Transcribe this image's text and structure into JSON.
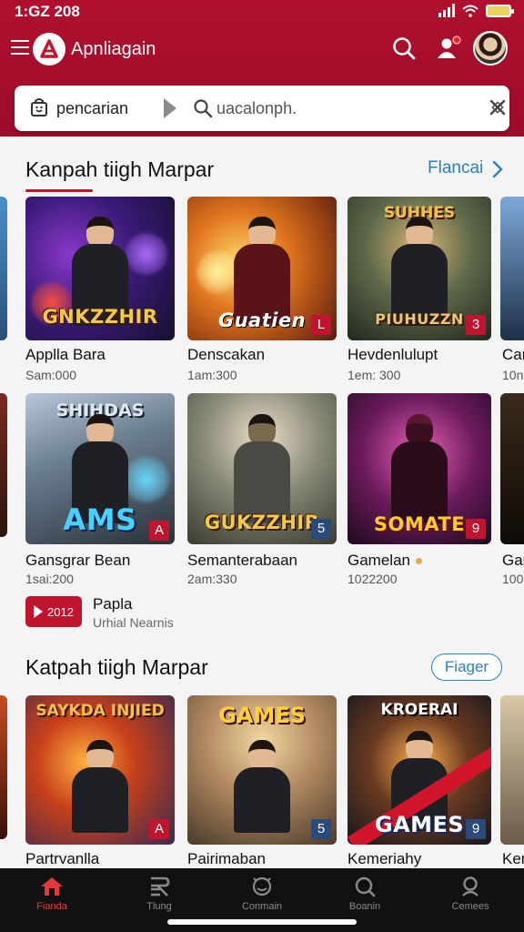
{
  "status": {
    "time": "1:GZ 208"
  },
  "appbar": {
    "title": "Apnliagain",
    "search_icon": "search-icon",
    "profile_icon": "user-alert-icon"
  },
  "search": {
    "category": "pencarian",
    "placeholder": "uacalonph."
  },
  "section1": {
    "title": "Kanpah tiigh Marpar",
    "more": "Flancai",
    "row1": [
      {
        "title": "Applla Bara",
        "sub": "Sam:000",
        "art": "GNKZZHIR",
        "badge": ""
      },
      {
        "title": "Denscakan",
        "sub": "1am:300",
        "art": "Guatien",
        "badge": "L"
      },
      {
        "title": "Hevdenlulupt",
        "sub": "1em: 300",
        "art": "PIUHUZZN",
        "top_art": "SUHHES",
        "badge": "3"
      }
    ],
    "row1_partial": {
      "title": "Car",
      "sub": "10n"
    },
    "row2": [
      {
        "title": "Gansgrar Bean",
        "sub": "1sai:200",
        "art": "AMS",
        "top_art": "SHIHDAS",
        "badge": "A"
      },
      {
        "title": "Semanterabaan",
        "sub": "2am:330",
        "art": "GUKZZHIR",
        "badge": "5"
      },
      {
        "title": "Gamelan",
        "sub": "1022200",
        "art": "SOMATE",
        "badge": "9"
      }
    ],
    "row2_partial": {
      "title": "Gar",
      "sub": "100"
    }
  },
  "promo": {
    "button": "2012",
    "title": "Papla",
    "sub": "Urhial Nearnis"
  },
  "section2": {
    "title": "Katpah tiigh Marpar",
    "more": "Fiager",
    "row": [
      {
        "title": "Partrvanlla",
        "top_art": "SAYKDA INJIED",
        "badge": "A"
      },
      {
        "title": "Pairimaban",
        "top_art": "GAMES",
        "badge": "5"
      },
      {
        "title": "Kemeriahy",
        "top_art": "KROERAI",
        "art": "GAMES",
        "badge": "9"
      }
    ],
    "row_partial": {
      "title": "Ker"
    }
  },
  "nav": [
    {
      "label": "Fianda",
      "icon": "home-icon"
    },
    {
      "label": "Tlung",
      "icon": "ranking-icon"
    },
    {
      "label": "Conmain",
      "icon": "community-icon"
    },
    {
      "label": "Boanin",
      "icon": "search-icon"
    },
    {
      "label": "Cemees",
      "icon": "games-icon"
    }
  ],
  "colors": {
    "brand": "#b0102e",
    "link": "#2d7fb8",
    "nav_active": "#e23a3a"
  }
}
